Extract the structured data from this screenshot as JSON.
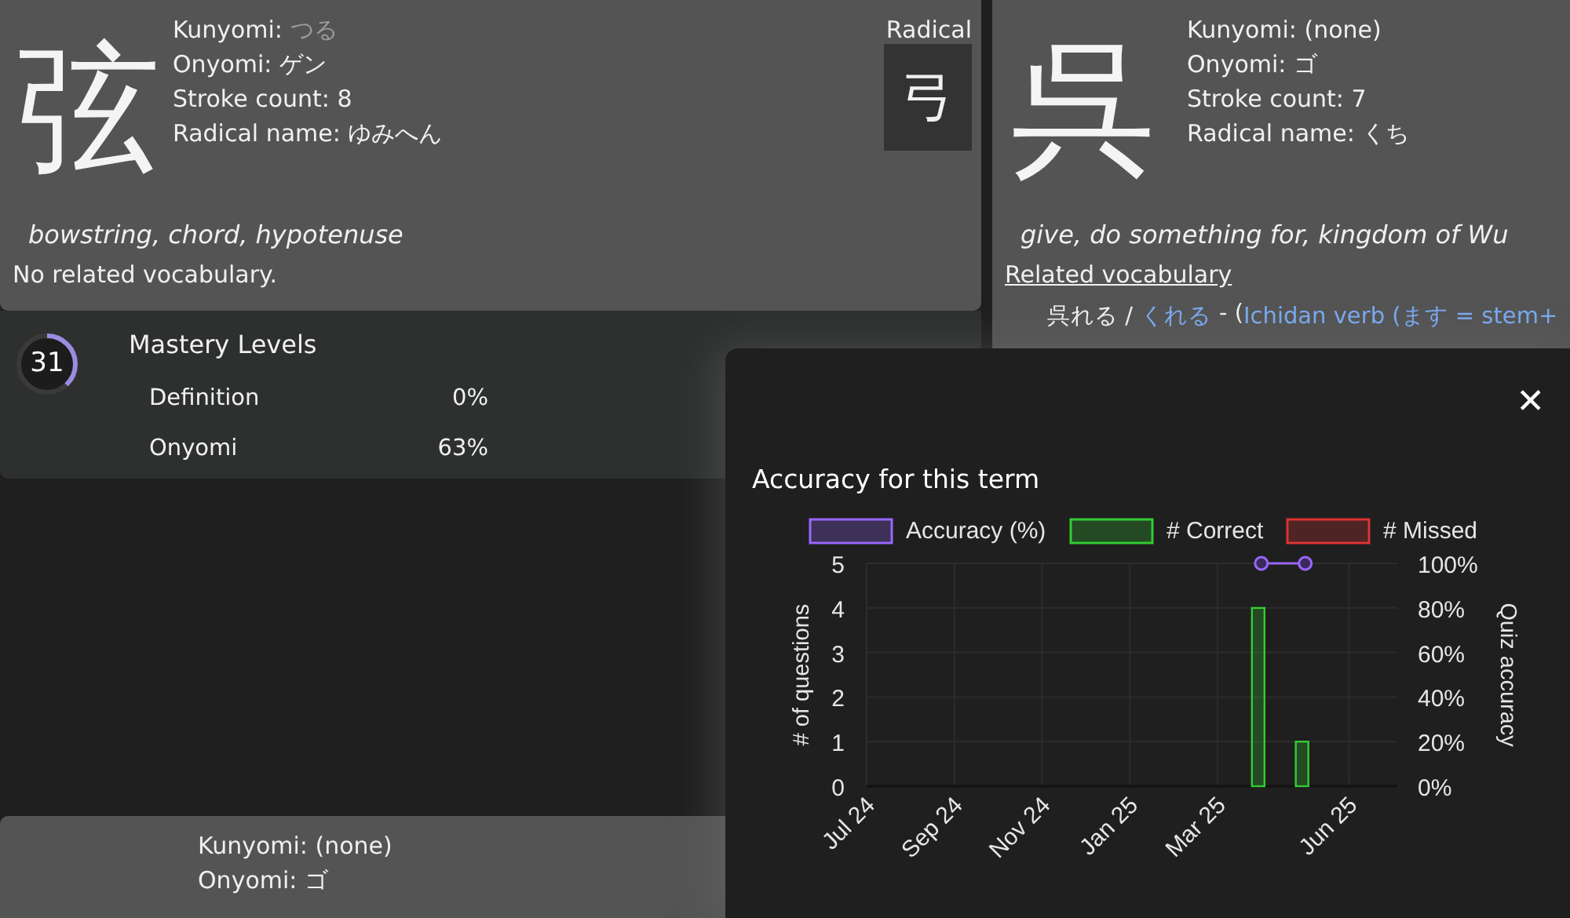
{
  "cards": [
    {
      "kanji": "弦",
      "fields": [
        {
          "label": "Kunyomi:",
          "value": "つる",
          "muted": true
        },
        {
          "label": "Onyomi:",
          "value": "ゲン",
          "muted": false
        },
        {
          "label": "Stroke count:",
          "value": "8",
          "muted": false
        },
        {
          "label": "Radical name:",
          "value": "ゆみへん",
          "muted": false
        }
      ],
      "radical": {
        "label": "Radical",
        "glyph": "弓"
      },
      "meaning": "bowstring, chord, hypotenuse",
      "vocabulary_note": "No related vocabulary."
    },
    {
      "kanji": "呉",
      "fields": [
        {
          "label": "Kunyomi:",
          "value": "(none)",
          "muted": false
        },
        {
          "label": "Onyomi:",
          "value": "ゴ",
          "muted": false
        },
        {
          "label": "Stroke count:",
          "value": "7",
          "muted": false
        },
        {
          "label": "Radical name:",
          "value": "くち",
          "muted": false
        }
      ],
      "meaning": "give, do something for, kingdom of Wu",
      "vocabulary_heading": "Related vocabulary",
      "vocabulary": [
        {
          "word": "呉れる /",
          "reading": "くれる",
          "separator": "- (",
          "gloss": "Ichidan verb (ます = stem+"
        }
      ]
    }
  ],
  "mastery": {
    "value": "31",
    "level": 0.38,
    "title": "Mastery Levels",
    "rows": [
      {
        "label": "Definition",
        "value": "0%"
      },
      {
        "label": "Onyomi",
        "value": "63%"
      }
    ]
  },
  "bottom_card": {
    "fields": [
      {
        "label": "Kunyomi:",
        "value": "(none)"
      },
      {
        "label": "Onyomi:",
        "value": "ゴ"
      }
    ]
  },
  "modal": {
    "close": "✕",
    "title": "Accuracy for this term",
    "chart_data": {
      "type": "bar",
      "ylabel": "# of questions",
      "y2label": "Quiz accuracy",
      "categories": [
        "Jul 24",
        null,
        "Sep 24",
        null,
        "Nov 24",
        null,
        "Jan 25",
        null,
        "Mar 25",
        null,
        null,
        "Jun 25"
      ],
      "ylim": [
        0,
        5
      ],
      "y2lim": [
        0,
        100
      ],
      "grid": true,
      "legend": true,
      "yticks": [
        0,
        1,
        2,
        3,
        4,
        5
      ],
      "y2ticks": [
        {
          "value": 0,
          "label": "0%"
        },
        {
          "value": 20,
          "label": "20%"
        },
        {
          "value": 40,
          "label": "40%"
        },
        {
          "value": 60,
          "label": "60%"
        },
        {
          "value": 80,
          "label": "80%"
        },
        {
          "value": 100,
          "label": "100%"
        }
      ],
      "series": [
        {
          "name": "Accuracy (%)",
          "color": "#9966ff",
          "type": "line",
          "axis": "y2",
          "marker": "circle",
          "values": [
            null,
            null,
            null,
            null,
            null,
            null,
            null,
            null,
            null,
            100,
            100,
            null
          ]
        },
        {
          "name": "# Correct",
          "color": "#33cc33",
          "type": "bar",
          "values": [
            null,
            null,
            null,
            null,
            null,
            null,
            null,
            null,
            null,
            4,
            1,
            null
          ]
        },
        {
          "name": "# Missed",
          "color": "#dd3333",
          "type": "bar",
          "values": [
            null,
            null,
            null,
            null,
            null,
            null,
            null,
            null,
            null,
            0,
            0,
            null
          ]
        }
      ]
    }
  }
}
